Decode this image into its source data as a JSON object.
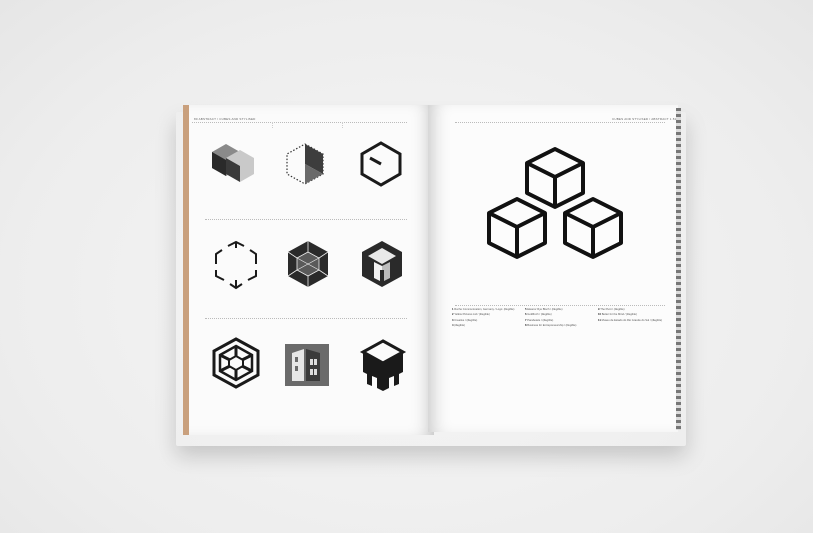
{
  "page_header_left": "80  ABSTRACT / CUBES AND STYLISED",
  "page_header_right": "CUBES AND STYLISED / ABSTRACT 1  81",
  "logos_left": [
    "overlapping-cubes-logo",
    "dotted-cube-logo",
    "clock-hexagon-logo",
    "broken-hexagon-logo",
    "faceted-hexagon-logo",
    "isometric-arch-logo",
    "woven-hexagon-logo",
    "building-block-logo",
    "dripping-cube-logo"
  ],
  "logo_right": "triple-cube-logo",
  "captions": [
    [
      {
        "num": "1",
        "text": "Roche Communication, Germany / Logo: (illegible)"
      },
      {
        "num": "2",
        "text": "Yellow Pictures Ltd / (illegible)"
      },
      {
        "num": "3",
        "text": "Creative / (illegible)"
      },
      {
        "num": "4",
        "text": "(illegible)"
      }
    ],
    [
      {
        "num": "5",
        "text": "Eleanor Rye Bloch / (illegible)"
      },
      {
        "num": "6",
        "text": "Goldfinch / (illegible)"
      },
      {
        "num": "7",
        "text": "Parabetele / (illegible)"
      },
      {
        "num": "8",
        "text": "Business for Entrepreneurship / (illegible)"
      }
    ],
    [
      {
        "num": "9",
        "text": "The Pivot / (illegible)"
      },
      {
        "num": "10",
        "text": "Better for the Mind / (illegible)"
      },
      {
        "num": "11",
        "text": "Museu de Estado do Rio Grande do Sul / (illegible)"
      }
    ]
  ],
  "colors": {
    "ink": "#1a1a1a",
    "mid": "#555555",
    "light": "#bdbdbd",
    "page": "#fbfbfb",
    "spine_edge": "#c9a07d"
  }
}
